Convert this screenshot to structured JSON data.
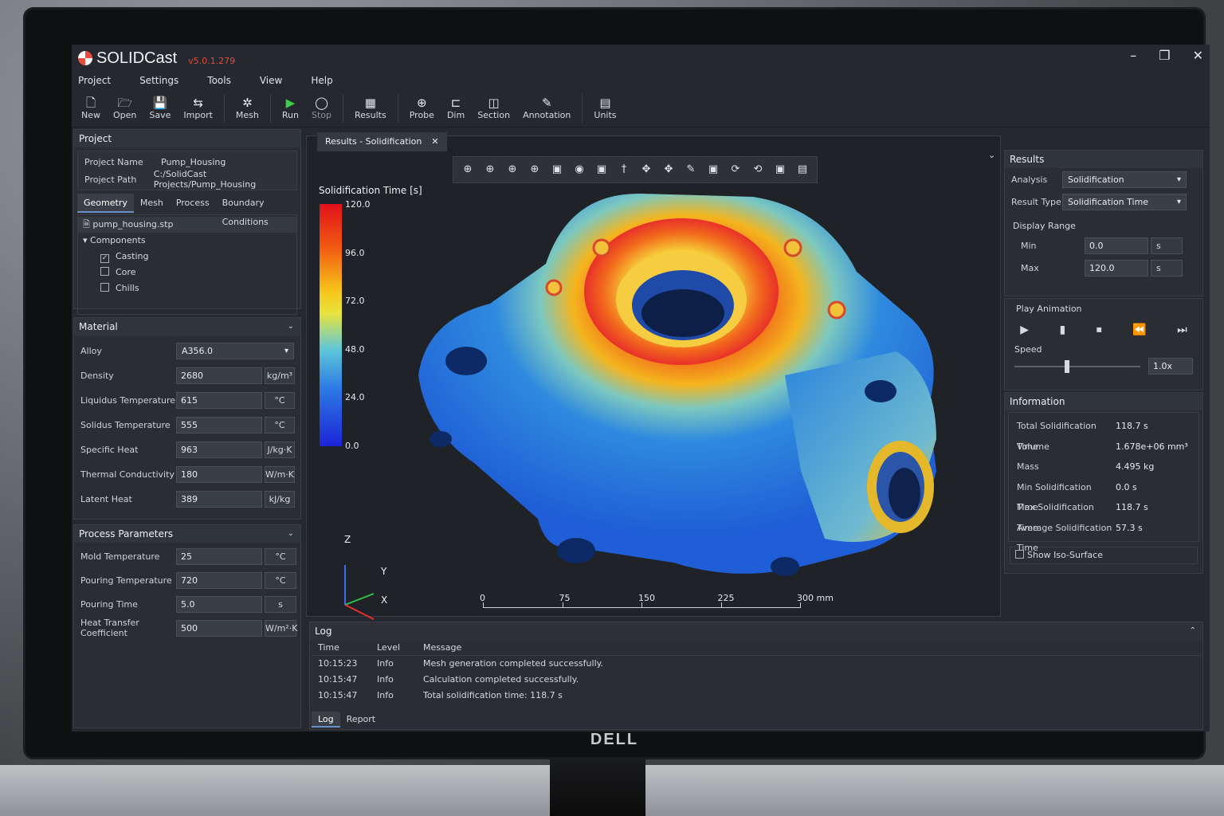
{
  "app": {
    "title": "SOLIDCast",
    "version": "v5.0.1.279",
    "window_controls": [
      "–",
      "❐",
      "✕"
    ]
  },
  "menu": [
    "Project",
    "Settings",
    "Tools",
    "View",
    "Help"
  ],
  "toolbar": [
    {
      "label": "New",
      "icon": "new-file-icon",
      "glyph": "🗋"
    },
    {
      "label": "Open",
      "icon": "open-folder-icon",
      "glyph": "🗁"
    },
    {
      "label": "Save",
      "icon": "save-icon",
      "glyph": "💾"
    },
    {
      "label": "Import",
      "icon": "import-icon",
      "glyph": "⇆"
    },
    {
      "label": "Mesh",
      "icon": "mesh-icon",
      "glyph": "✲"
    },
    {
      "label": "Run",
      "icon": "run-icon",
      "glyph": "▶"
    },
    {
      "label": "Stop",
      "icon": "stop-icon",
      "glyph": "◯"
    },
    {
      "label": "Results",
      "icon": "results-icon",
      "glyph": "▦"
    },
    {
      "label": "Probe",
      "icon": "probe-icon",
      "glyph": "⊕"
    },
    {
      "label": "Dim",
      "icon": "dimension-icon",
      "glyph": "⊏"
    },
    {
      "label": "Section",
      "icon": "section-icon",
      "glyph": "◫"
    },
    {
      "label": "Annotation",
      "icon": "annotation-icon",
      "glyph": "✎"
    },
    {
      "label": "Units",
      "icon": "units-icon",
      "glyph": "▤"
    }
  ],
  "project": {
    "header": "Project",
    "name_label": "Project Name",
    "name_value": "Pump_Housing",
    "path_label": "Project Path",
    "path_value": "C:/SolidCast Projects/Pump_Housing",
    "tabs": [
      "Geometry",
      "Mesh",
      "Process",
      "Boundary Conditions"
    ],
    "file": "pump_housing.stp",
    "components_label": "Components",
    "components": [
      {
        "label": "Casting",
        "checked": true
      },
      {
        "label": "Core",
        "checked": false
      },
      {
        "label": "Chills",
        "checked": false
      }
    ]
  },
  "material": {
    "header": "Material",
    "alloy_label": "Alloy",
    "alloy_value": "A356.0",
    "props": [
      {
        "label": "Density",
        "value": "2680",
        "unit": "kg/m³"
      },
      {
        "label": "Liquidus Temperature",
        "value": "615",
        "unit": "°C"
      },
      {
        "label": "Solidus Temperature",
        "value": "555",
        "unit": "°C"
      },
      {
        "label": "Specific Heat",
        "value": "963",
        "unit": "J/kg·K"
      },
      {
        "label": "Thermal Conductivity",
        "value": "180",
        "unit": "W/m·K"
      },
      {
        "label": "Latent Heat",
        "value": "389",
        "unit": "kJ/kg"
      }
    ]
  },
  "process": {
    "header": "Process Parameters",
    "params": [
      {
        "label": "Mold Temperature",
        "value": "25",
        "unit": "°C"
      },
      {
        "label": "Pouring Temperature",
        "value": "720",
        "unit": "°C"
      },
      {
        "label": "Pouring Time",
        "value": "5.0",
        "unit": "s"
      },
      {
        "label": "Heat Transfer Coefficient",
        "value": "500",
        "unit": "W/m²·K"
      }
    ]
  },
  "viewport": {
    "tab_label": "Results - Solidification",
    "legend_title": "Solidification Time [s]",
    "legend_ticks": [
      "120.0",
      "96.0",
      "72.0",
      "48.0",
      "24.0",
      "0.0"
    ],
    "scale_ticks": [
      "0",
      "75",
      "150",
      "225",
      "300 mm"
    ],
    "axes": [
      "Z",
      "Y",
      "X"
    ],
    "tools": [
      "⊕",
      "⊕",
      "⊕",
      "⊕",
      "▣",
      "◉",
      "▣",
      "†",
      "✥",
      "✥",
      "✎",
      "▣",
      "⟳",
      "⟲",
      "▣",
      "▤"
    ]
  },
  "results": {
    "header": "Results",
    "analysis_label": "Analysis",
    "analysis_value": "Solidification",
    "type_label": "Result Type",
    "type_value": "Solidification Time",
    "range_label": "Display Range",
    "min_label": "Min",
    "min_value": "0.0",
    "min_unit": "s",
    "max_label": "Max",
    "max_value": "120.0",
    "max_unit": "s",
    "anim_label": "Play Animation",
    "speed_label": "Speed",
    "speed_value": "1.0x",
    "speed_level": 0.4
  },
  "information": {
    "header": "Information",
    "rows": [
      {
        "k": "Total Solidification Time",
        "v": "118.7 s"
      },
      {
        "k": "Volume",
        "v": "1.678e+06 mm³"
      },
      {
        "k": "Mass",
        "v": "4.495 kg"
      },
      {
        "k": "Min Solidification Time",
        "v": "0.0 s"
      },
      {
        "k": "Max Solidification Time",
        "v": "118.7 s"
      },
      {
        "k": "Average Solidification Time",
        "v": "57.3 s"
      }
    ],
    "iso_label": "Show Iso-Surface"
  },
  "log": {
    "header": "Log",
    "columns": [
      "Time",
      "Level",
      "Message"
    ],
    "rows": [
      {
        "time": "10:15:23",
        "level": "Info",
        "message": "Mesh generation completed successfully."
      },
      {
        "time": "10:15:47",
        "level": "Info",
        "message": "Calculation completed successfully."
      },
      {
        "time": "10:15:47",
        "level": "Info",
        "message": "Total solidification time: 118.7 s"
      }
    ],
    "tabs": [
      "Log",
      "Report"
    ]
  },
  "bezel_brand": "DELL"
}
